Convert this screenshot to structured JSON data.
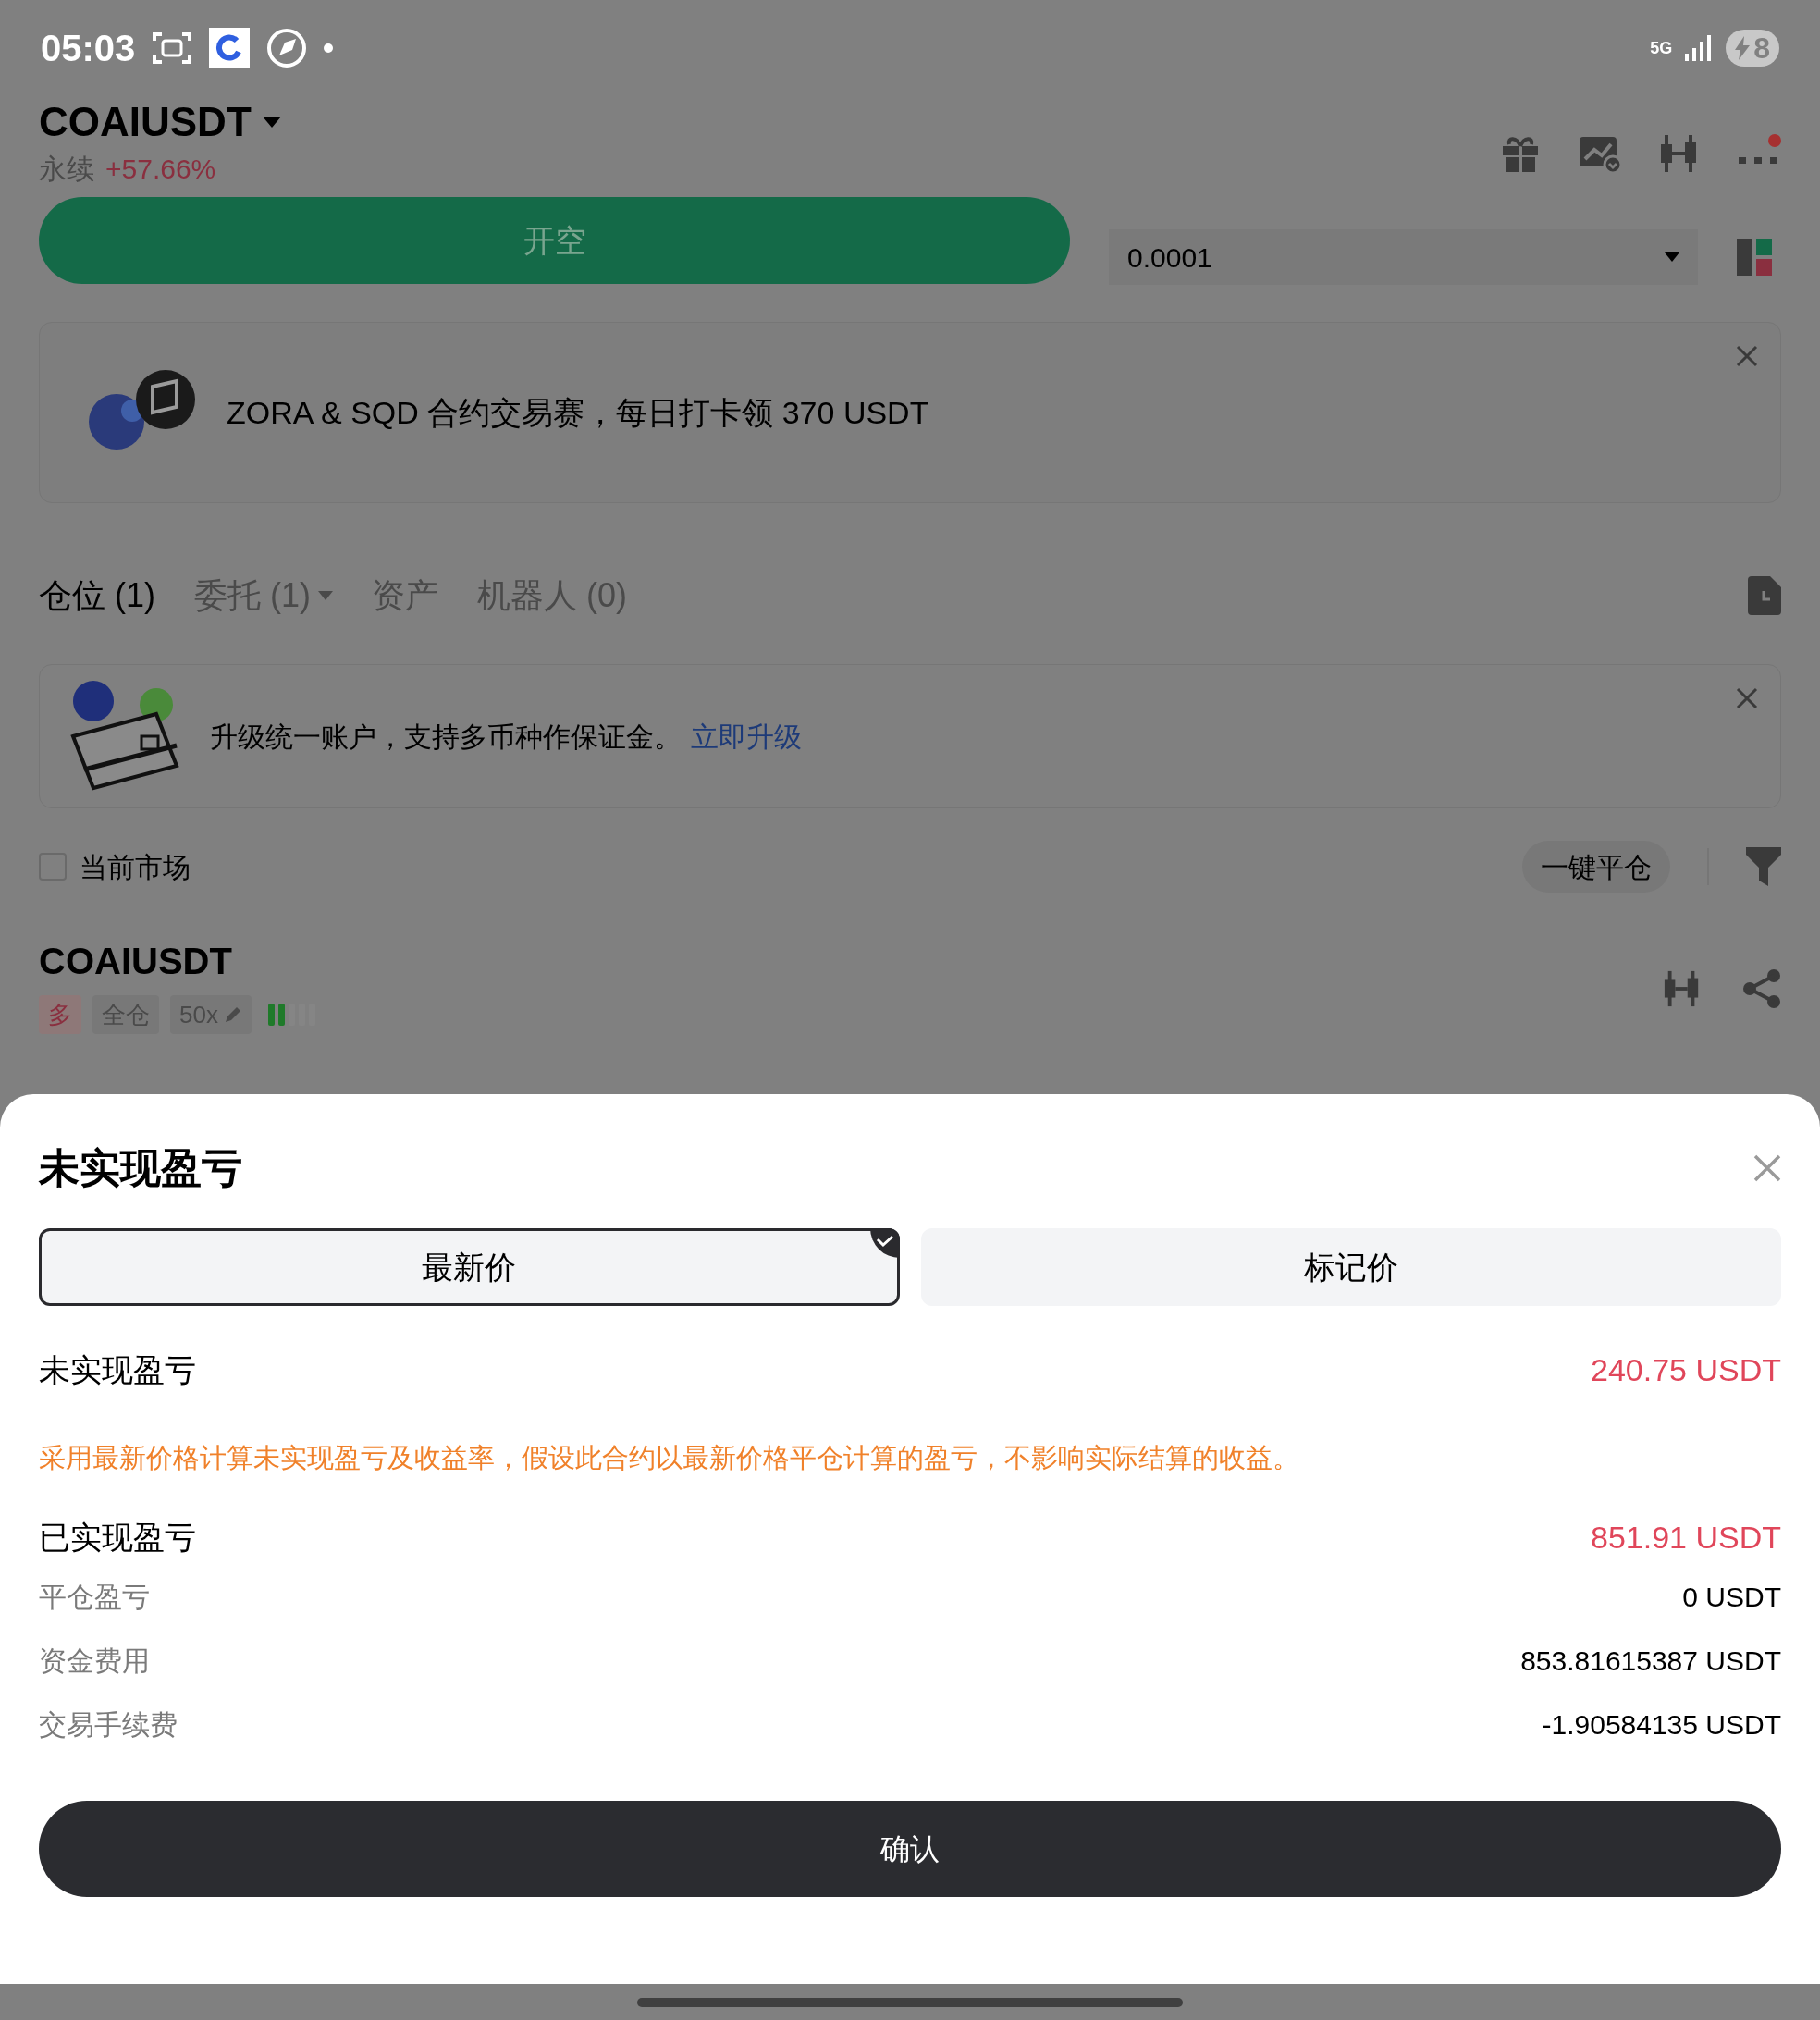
{
  "status_bar": {
    "time": "05:03",
    "network": "5G",
    "battery": "8"
  },
  "header": {
    "symbol": "COAIUSDT",
    "contract_type": "永续",
    "change": "+57.66%",
    "alert": true
  },
  "trade": {
    "button": "开空",
    "quantity": "0.0001"
  },
  "promo": {
    "text": "ZORA & SQD 合约交易赛，每日打卡领 370 USDT"
  },
  "tabs": [
    {
      "label": "仓位 (1)",
      "selected": true,
      "dropdown": false
    },
    {
      "label": "委托 (1)",
      "selected": false,
      "dropdown": true
    },
    {
      "label": "资产",
      "selected": false,
      "dropdown": false
    },
    {
      "label": "机器人 (0)",
      "selected": false,
      "dropdown": false
    }
  ],
  "notice": {
    "text": "升级统一账户，支持多币种作保证金。",
    "link": "立即升级"
  },
  "filter": {
    "label": "当前市场",
    "checked": false,
    "close_all": "一键平仓"
  },
  "position": {
    "symbol": "COAIUSDT",
    "tags": [
      {
        "kind": "side",
        "label": "多"
      },
      {
        "kind": "margin",
        "label": "全仓"
      },
      {
        "kind": "leverage",
        "label": "50x"
      }
    ]
  },
  "sheet": {
    "title": "未实现盈亏",
    "tabs": [
      {
        "label": "最新价",
        "selected": true
      },
      {
        "label": "标记价",
        "selected": false
      }
    ],
    "unrealized": {
      "label": "未实现盈亏",
      "value": "240.75 USDT",
      "note": "采用最新价格计算未实现盈亏及收益率，假设此合约以最新价格平仓计算的盈亏，不影响实际结算的收益。"
    },
    "realized": {
      "label": "已实现盈亏",
      "value": "851.91 USDT",
      "items": [
        {
          "label": "平仓盈亏",
          "value": "0 USDT"
        },
        {
          "label": "资金费用",
          "value": "853.81615387 USDT"
        },
        {
          "label": "交易手续费",
          "value": "-1.90584135 USDT"
        }
      ]
    },
    "confirm": "确认"
  }
}
